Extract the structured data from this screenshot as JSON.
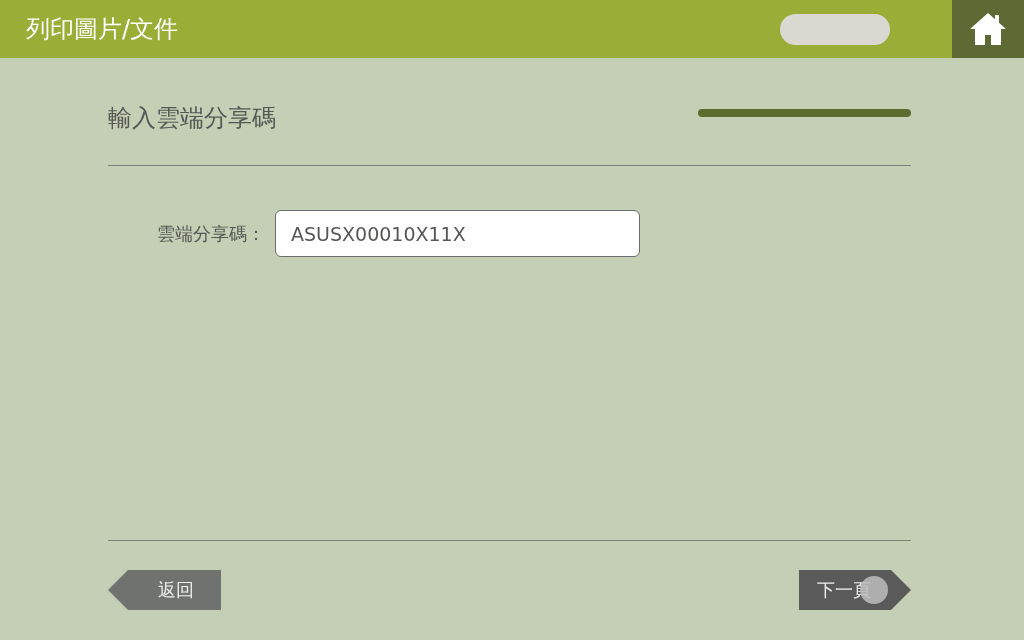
{
  "header": {
    "title": "列印圖片/文件"
  },
  "page": {
    "title": "輸入雲端分享碼",
    "progress": {
      "level": 1
    }
  },
  "form": {
    "fields": [
      {
        "label": "雲端分享碼：",
        "value": "ASUSX00010X11X"
      }
    ]
  },
  "buttons": [
    {
      "label": "返回",
      "kind": "back",
      "pressed": false
    },
    {
      "label": "下一頁",
      "kind": "next",
      "pressed": true
    }
  ]
}
